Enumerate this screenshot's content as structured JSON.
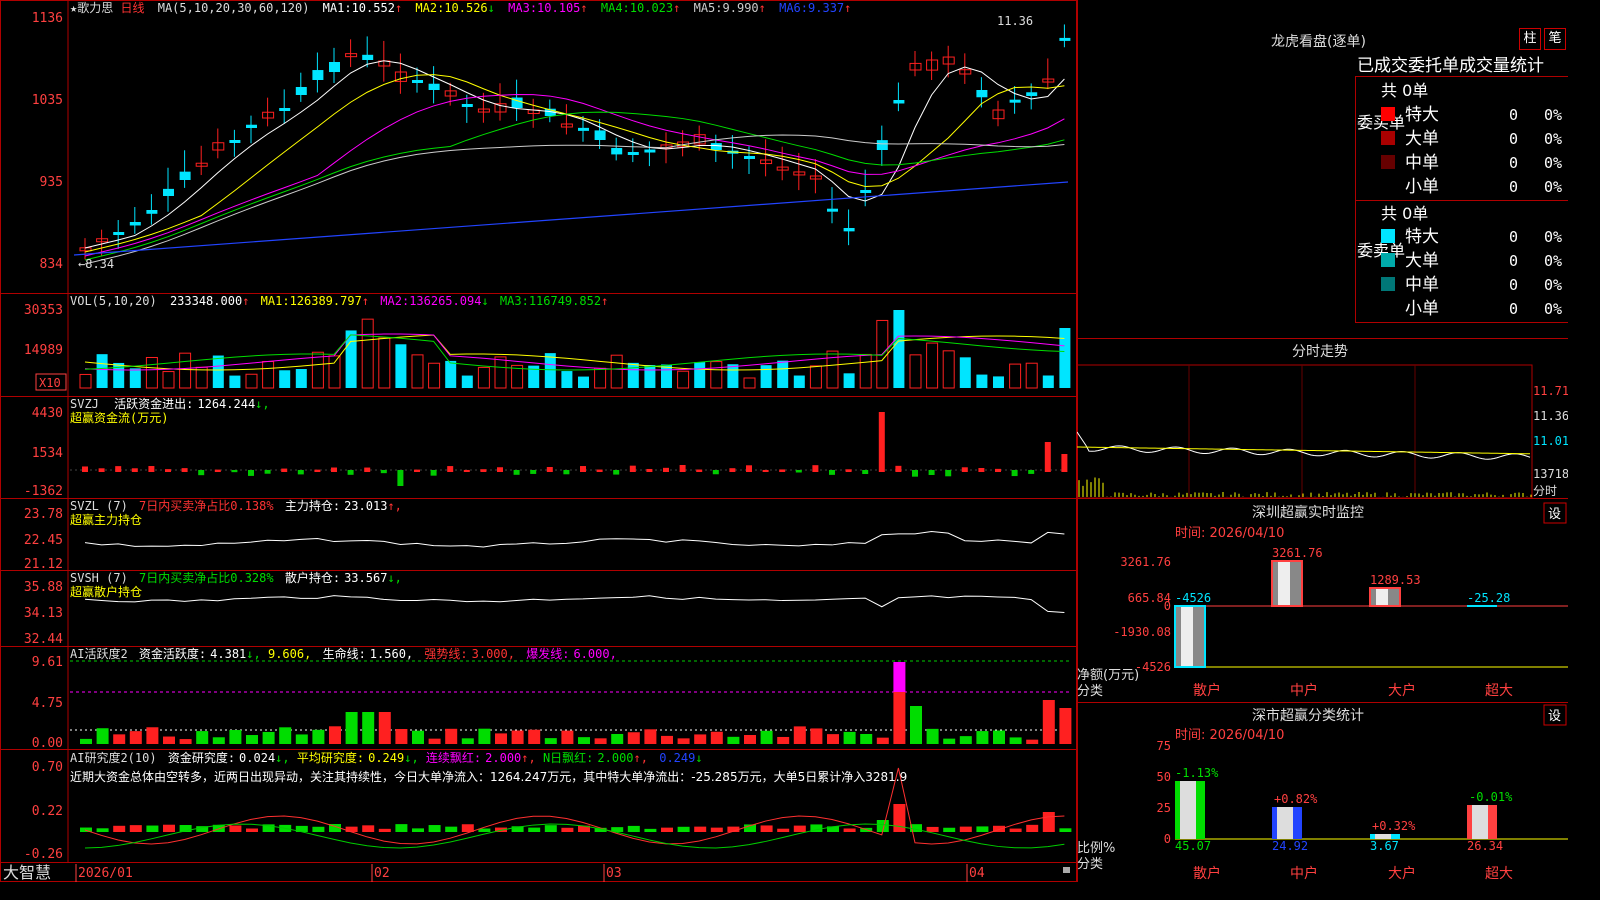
{
  "stock_title": "★歌力思",
  "period": "日线",
  "ma_header": {
    "label": "MA(5,10,20,30,60,120)",
    "items": [
      {
        "name": "MA1:",
        "value": "10.552",
        "arrow": "↑",
        "color": "#ffffff"
      },
      {
        "name": "MA2:",
        "value": "10.526",
        "arrow": "↓",
        "color": "#ffff00"
      },
      {
        "name": "MA3:",
        "value": "10.105",
        "arrow": "↑",
        "color": "#ff00ff"
      },
      {
        "name": "MA4:",
        "value": "10.023",
        "arrow": "↑",
        "color": "#00dd00"
      },
      {
        "name": "MA5:",
        "value": "9.990",
        "arrow": "↑",
        "color": "#cccccc"
      },
      {
        "name": "MA6:",
        "value": "9.337",
        "arrow": "↑",
        "color": "#2244ff"
      }
    ]
  },
  "price_axis": [
    "1136",
    "1035",
    "935",
    "834"
  ],
  "high_mark": "11.36",
  "low_mark": "8.34",
  "vol_header": {
    "label": "VOL(5,10,20)",
    "value": "233348.000",
    "arrow": "↑",
    "items": [
      {
        "name": "MA1:",
        "value": "126389.797",
        "arrow": "↑",
        "color": "#ffff00"
      },
      {
        "name": "MA2:",
        "value": "136265.094",
        "arrow": "↓",
        "color": "#ff00ff"
      },
      {
        "name": "MA3:",
        "value": "116749.852",
        "arrow": "↑",
        "color": "#00dd00"
      }
    ]
  },
  "vol_axis": [
    "30353",
    "14989"
  ],
  "vol_unit": "X10",
  "svzj": {
    "name": "SVZJ",
    "label": "活跃资金进出:",
    "value": "1264.244",
    "arrow": "↓,",
    "sub": "超赢资金流(万元)",
    "axis": [
      "4430",
      "1534",
      "-1362"
    ]
  },
  "svzl": {
    "name": "SVZL (7)",
    "label1": "7日内买卖净占比0.138%",
    "label2": "主力持仓:",
    "value": "23.013",
    "arrow": "↑,",
    "sub": "超赢主力持仓",
    "axis": [
      "23.78",
      "22.45",
      "21.12"
    ]
  },
  "svsh": {
    "name": "SVSH (7)",
    "label1": "7日内买卖净占比0.328%",
    "label2": "散户持仓:",
    "value": "33.567",
    "arrow": "↓,",
    "sub": "超赢散户持仓",
    "axis": [
      "35.88",
      "34.13",
      "32.44"
    ]
  },
  "ai1": {
    "name": "AI活跃度2",
    "l1": "资金活跃度:",
    "v1": "4.381",
    "a1": "↓,",
    "v2": "9.606,",
    "l3": "生命线:",
    "v3": "1.560,",
    "l4": "强势线:",
    "v4": "3.000,",
    "l5": "爆发线:",
    "v5": "6.000,",
    "axis": [
      "9.61",
      "4.75",
      "0.00"
    ]
  },
  "ai2": {
    "name": "AI研究度2(10)",
    "l1": "资金研究度:",
    "v1": "0.024",
    "a1": "↓,",
    "l2": "平均研究度:",
    "v2": "0.249",
    "a2": "↓,",
    "l3": "连续飘红:",
    "v3": "2.000",
    "a3": "↑,",
    "l4": "N日飘红:",
    "v4": "2.000",
    "a4": "↑,",
    "v5": "0.249",
    "a5": "↓",
    "axis": [
      "0.70",
      "0.22",
      "-0.26"
    ],
    "comment": "近期大资金总体由空转多，近两日出现异动，关注其持续性，今日大单净流入：1264.247万元，其中特大单净流出：-25.285万元，大单5日累计净入3281.9"
  },
  "bottom_brand": "大智慧",
  "date_axis": [
    "2026/01",
    "02",
    "03",
    "04"
  ],
  "right": {
    "title": "龙虎看盘(逐单)",
    "btn1": "柱",
    "btn2": "笔",
    "tabs": [
      "已成交",
      "委托单",
      "成交量统计"
    ],
    "buy": {
      "side_label": "委买单",
      "total": "共 0单",
      "rows": [
        {
          "label": "特大",
          "val": "0",
          "pct": "0%",
          "color": "#ff0000"
        },
        {
          "label": "大单",
          "val": "0",
          "pct": "0%",
          "color": "#aa0000"
        },
        {
          "label": "中单",
          "val": "0",
          "pct": "0%",
          "color": "#660000"
        },
        {
          "label": "小单",
          "val": "0",
          "pct": "0%",
          "color": ""
        }
      ]
    },
    "sell": {
      "side_label": "委卖单",
      "total": "共 0单",
      "rows": [
        {
          "label": "特大",
          "val": "0",
          "pct": "0%",
          "color": "#00e5ff"
        },
        {
          "label": "大单",
          "val": "0",
          "pct": "0%",
          "color": "#00aaaa"
        },
        {
          "label": "中单",
          "val": "0",
          "pct": "0%",
          "color": "#007777"
        },
        {
          "label": "小单",
          "val": "0",
          "pct": "0%",
          "color": ""
        }
      ]
    },
    "intraday": {
      "title": "分时走势",
      "axis": [
        "11.71",
        "11.36",
        "11.01",
        "13718"
      ],
      "unit": "分时"
    },
    "szmon": {
      "title": "深圳超赢实时监控",
      "btn": "设",
      "time": "时间: 2026/04/10",
      "axis": [
        "3261.76",
        "665.84",
        "0",
        "-1930.08",
        "-4526"
      ],
      "net_label": "净额(万元)",
      "cat_label": "分类",
      "cats": [
        "散户",
        "中户",
        "大户",
        "超大"
      ],
      "values": [
        "-4526",
        "3261.76",
        "1289.53",
        "-25.28"
      ]
    },
    "szcls": {
      "title": "深市超赢分类统计",
      "btn": "设",
      "time": "时间: 2026/04/10",
      "axis": [
        "75",
        "50",
        "25",
        "0"
      ],
      "ratio_label": "比例%",
      "cat_label": "分类",
      "cats": [
        "散户",
        "中户",
        "大户",
        "超大"
      ],
      "values": [
        "45.07",
        "24.92",
        "3.67",
        "26.34"
      ],
      "changes": [
        "-1.13%",
        "+0.82%",
        "+0.32%",
        "-0.01%"
      ]
    }
  }
}
